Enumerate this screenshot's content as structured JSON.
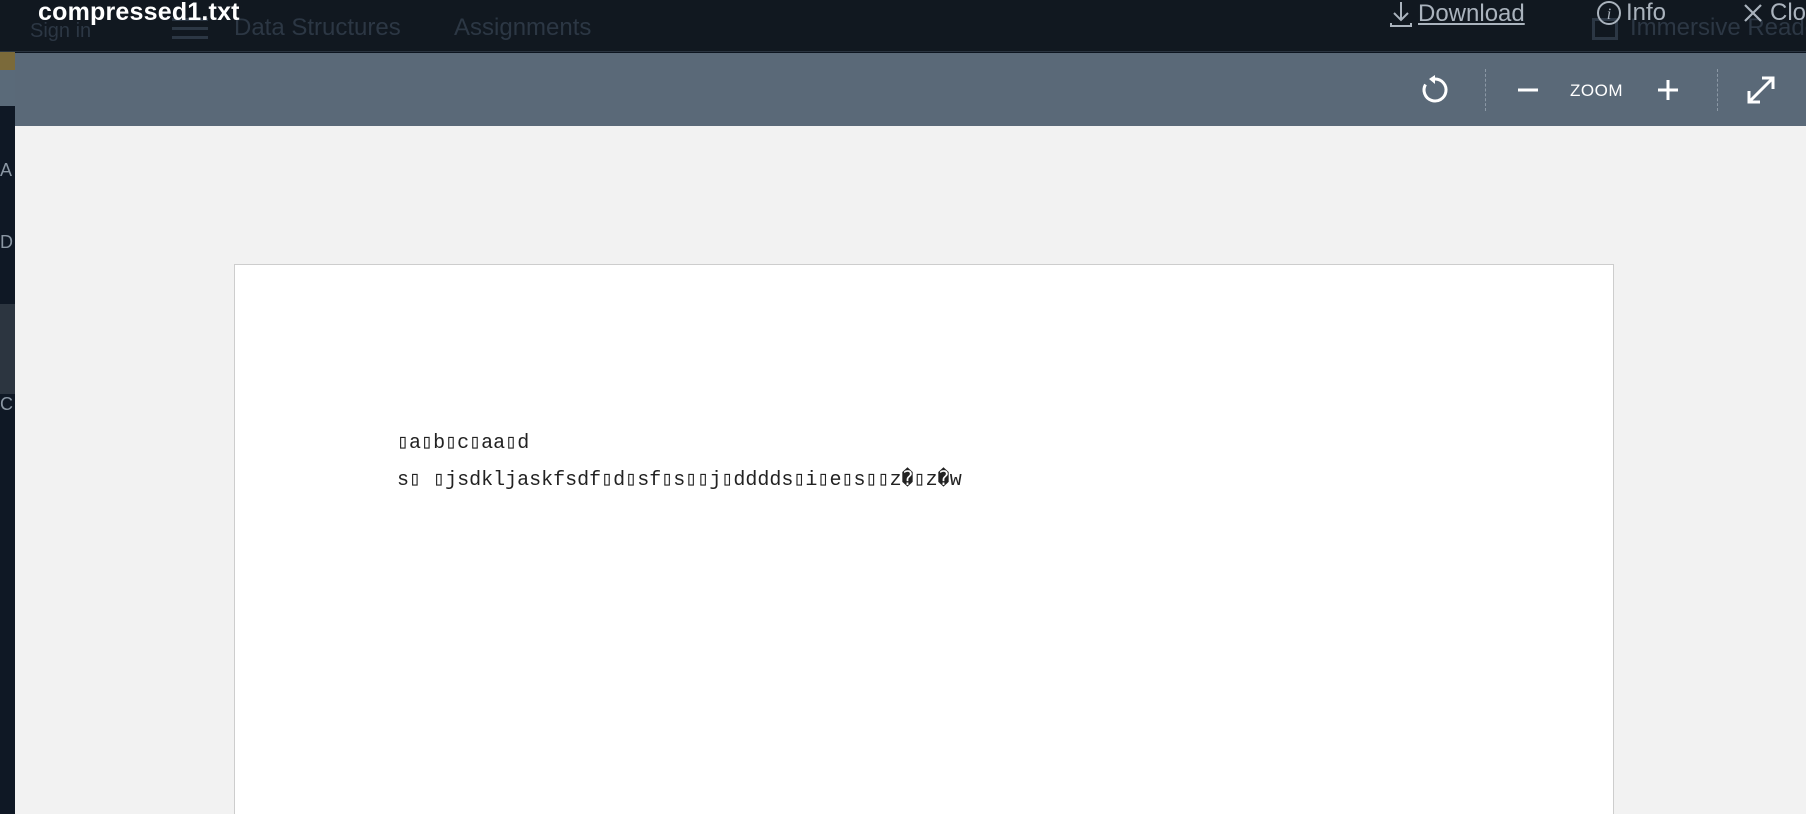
{
  "viewer": {
    "file_name": "compressed1.txt",
    "download_label": "Download",
    "info_label": "Info",
    "close_label": "Clo"
  },
  "background_app": {
    "nav_items": [
      "Data Structures",
      "Assignments"
    ],
    "top_left_text": "Sign in",
    "right_text": "Immersive Reader",
    "side_letters": [
      "A",
      "D",
      "C"
    ]
  },
  "toolbar": {
    "zoom_label": "ZOOM"
  },
  "document": {
    "lines": [
      "▯a▯b▯c▯aa▯d",
      "s▯ ▯jsdkljaskfsdf▯d▯sf▯s▯▯j▯dddds▯i▯e▯s▯▯z�▯z�w"
    ]
  },
  "colors": {
    "header_bg": "#111820",
    "toolbar_bg": "#5a6978",
    "viewer_bg": "#f2f2f2",
    "page_bg": "#ffffff"
  }
}
